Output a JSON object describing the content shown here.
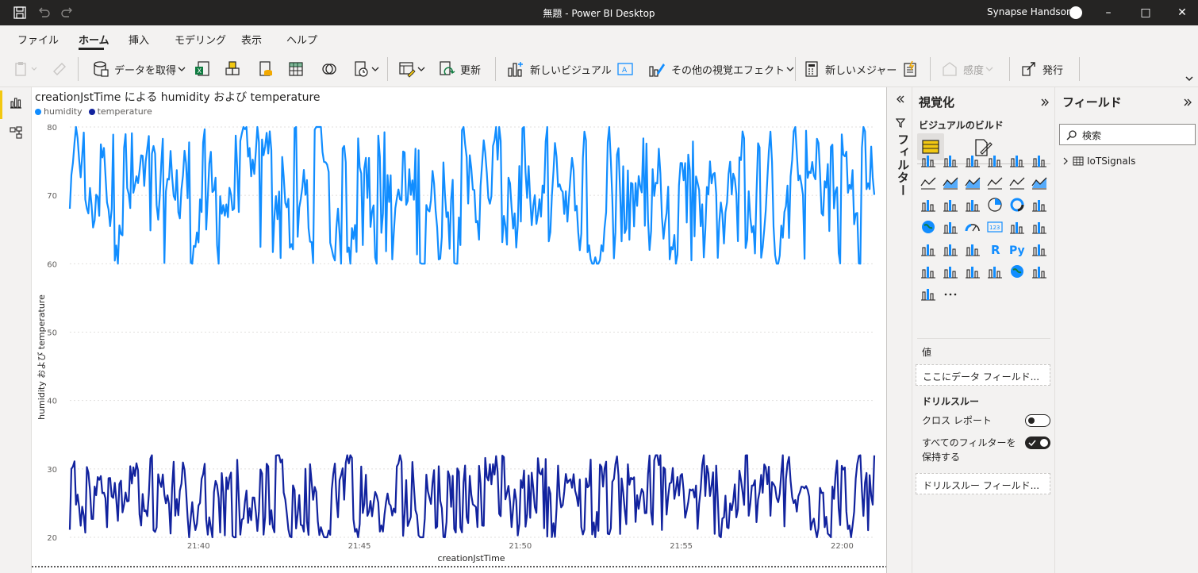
{
  "window": {
    "title": "無題 - Power BI Desktop",
    "user": "Synapse Handson"
  },
  "menu": {
    "tabs": [
      "ファイル",
      "ホーム",
      "挿入",
      "モデリング",
      "表示",
      "ヘルプ"
    ],
    "active": "ホーム"
  },
  "ribbon": {
    "get_data": "データを取得",
    "refresh": "更新",
    "new_visual": "新しいビジュアル",
    "more_visuals": "その他の視覚エフェクト",
    "new_measure": "新しいメジャー",
    "sensitivity": "感度",
    "publish": "発行"
  },
  "filter_pane": {
    "label": "フィルター"
  },
  "viz_pane": {
    "title": "視覚化",
    "build_label": "ビジュアルのビルド",
    "values_label": "値",
    "values_placeholder": "ここにデータ フィールド...",
    "drillthrough_label": "ドリルスルー",
    "cross_report_label": "クロス レポート",
    "keep_filters_line1": "すべてのフィルターを",
    "keep_filters_line2": "保持する",
    "drill_placeholder": "ドリルスルー フィールド...",
    "icons": [
      "stacked-bar-chart-icon",
      "stacked-column-chart-icon",
      "clustered-bar-chart-icon",
      "clustered-column-chart-icon",
      "100-stacked-bar-chart-icon",
      "100-stacked-column-chart-icon",
      "line-chart-icon",
      "area-chart-icon",
      "stacked-area-chart-icon",
      "line-column-chart-icon",
      "line-clustered-column-chart-icon",
      "ribbon-chart-icon",
      "waterfall-chart-icon",
      "funnel-chart-icon",
      "scatter-chart-icon",
      "pie-chart-icon",
      "donut-chart-icon",
      "treemap-icon",
      "map-icon",
      "filled-map-icon",
      "gauge-icon",
      "card-icon",
      "multi-row-card-icon",
      "kpi-icon",
      "slicer-icon",
      "table-icon",
      "matrix-icon",
      "r-visual-icon",
      "python-visual-icon",
      "key-influencers-icon",
      "decomposition-tree-icon",
      "qna-icon",
      "smart-narrative-icon",
      "paginated-report-icon",
      "azure-map-icon",
      "power-apps-icon",
      "power-automate-icon",
      "more-visuals-icon"
    ]
  },
  "fields_pane": {
    "title": "フィールド",
    "search_placeholder": "検索",
    "tables": [
      "IoTSignals"
    ]
  },
  "colors": {
    "humidity": "#118dff",
    "temperature": "#12239e",
    "accent": "#f2c811",
    "titlebar": "#252423"
  },
  "chart_data": {
    "type": "line",
    "title": "creationJstTime による humidity および temperature",
    "xlabel": "creationJstTime",
    "ylabel": "humidity および temperature",
    "x_ticks": [
      "21:40",
      "21:45",
      "21:50",
      "21:55",
      "22:00"
    ],
    "y_ticks": [
      20,
      30,
      40,
      50,
      60,
      70,
      80
    ],
    "ylim": [
      20,
      80
    ],
    "x_range": [
      "21:36",
      "22:01"
    ],
    "grid": "horizontal dotted",
    "legend_position": "top-left",
    "series": [
      {
        "name": "humidity",
        "value_range": [
          60,
          80
        ]
      },
      {
        "name": "temperature",
        "value_range": [
          20,
          32
        ]
      }
    ]
  }
}
